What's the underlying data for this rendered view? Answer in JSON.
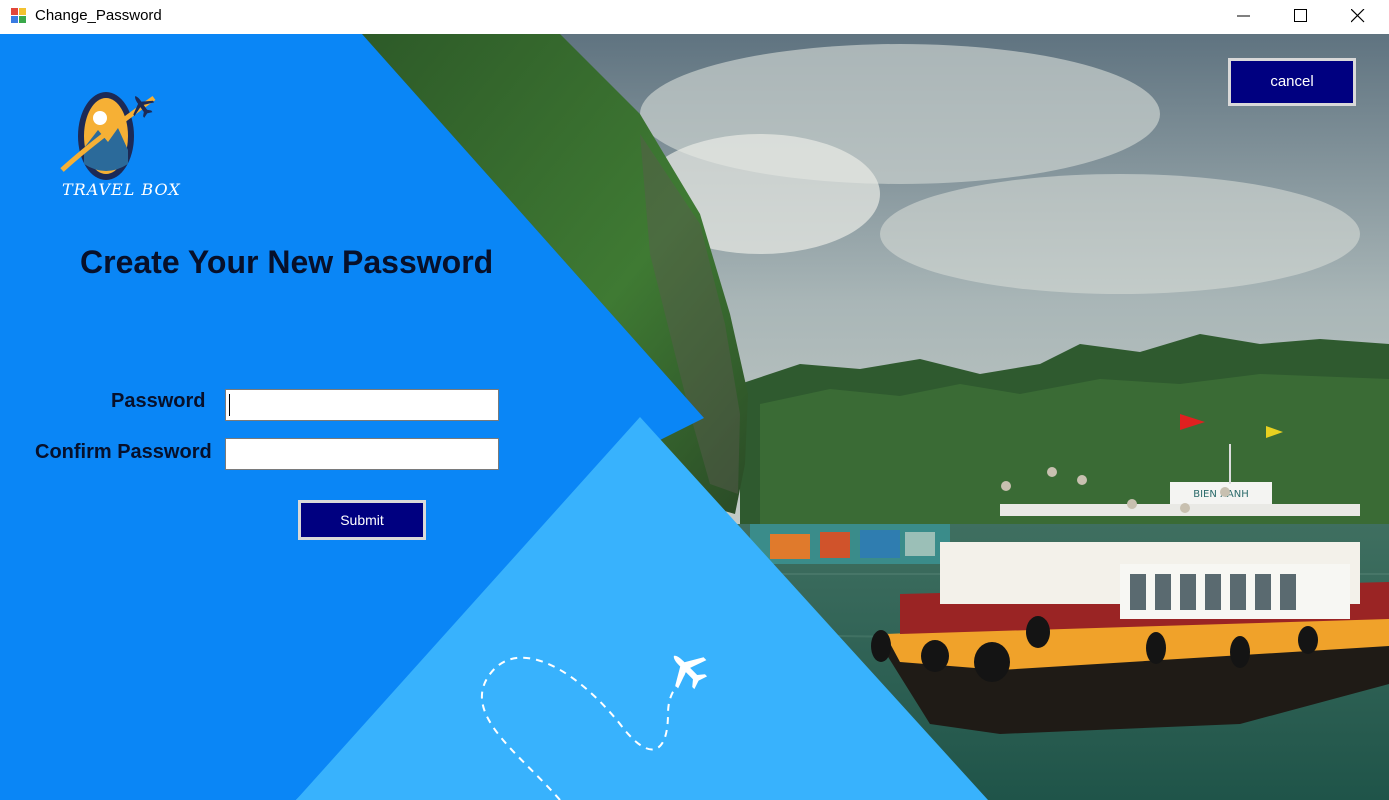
{
  "window": {
    "title": "Change_Password",
    "controls": [
      "minimize-icon",
      "maximize-icon",
      "close-icon"
    ]
  },
  "brand": {
    "logo_text": "TRAVEL BOX"
  },
  "form": {
    "heading": "Create Your New Password",
    "password_label": "Password",
    "password_value": "",
    "confirm_label": "Confirm Password",
    "confirm_value": "",
    "submit_label": "Submit"
  },
  "actions": {
    "cancel_label": "cancel"
  },
  "boat": {
    "name": "BIEN XANH"
  },
  "colors": {
    "primary_panel": "#0a86f6",
    "secondary_panel": "#38b2fd",
    "button_bg": "#000080",
    "button_border": "#d9d9d9",
    "heading_text": "#07102a"
  }
}
